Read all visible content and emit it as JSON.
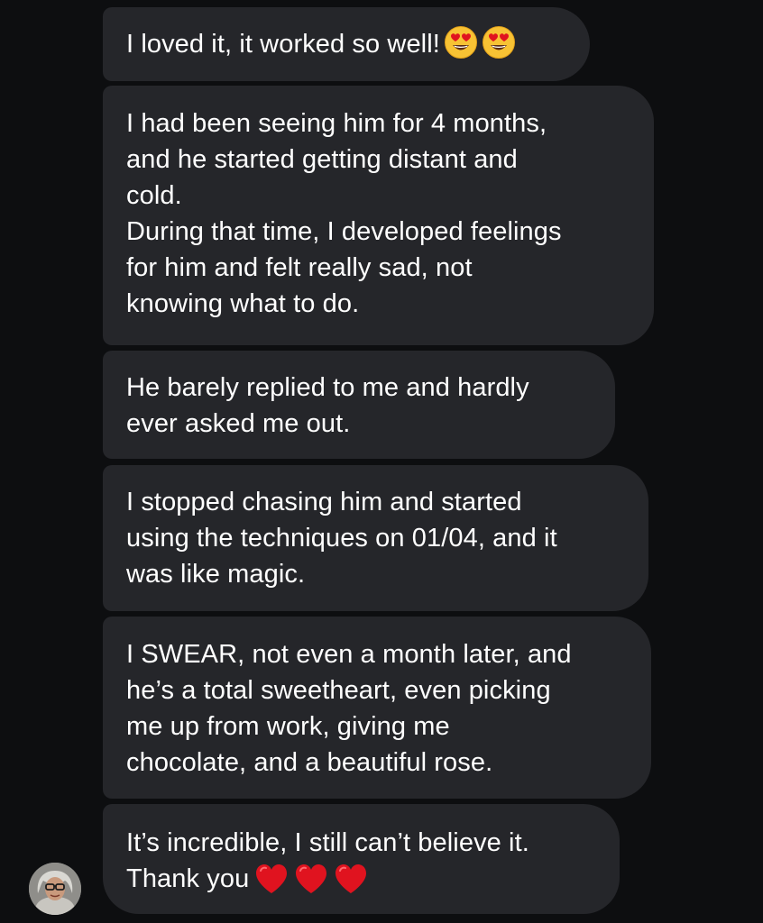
{
  "messages": [
    {
      "id": "msg1",
      "lines": "I loved it, it worked so well!",
      "trailing_emojis": [
        "smiling-face-with-heart-eyes",
        "smiling-face-with-heart-eyes"
      ]
    },
    {
      "id": "msg2",
      "lines": "I had been seeing him for 4 months,\nand he started getting distant and\ncold.\nDuring that time, I developed feelings\nfor him and felt really sad, not\nknowing what to do."
    },
    {
      "id": "msg3",
      "lines": "He barely replied to me and hardly\never asked me out."
    },
    {
      "id": "msg4",
      "lines": "I stopped chasing him and started\nusing the techniques on 01/04, and it\nwas like magic."
    },
    {
      "id": "msg5",
      "lines": "I SWEAR, not even a month later, and\nhe’s a total sweetheart, even picking\nme up from work, giving me\nchocolate, and a beautiful rose."
    },
    {
      "id": "msg6",
      "line1": "It’s incredible, I still can’t believe it.",
      "line2": "Thank you",
      "trailing_emojis": [
        "red-heart",
        "red-heart",
        "red-heart"
      ]
    }
  ],
  "colors": {
    "background": "#0d0e10",
    "bubble": "#25262a",
    "text": "#ffffff",
    "heart": "#e0131f",
    "emoji_face": "#f7c234"
  },
  "sender": {
    "avatar_icon": "user-avatar-photo"
  }
}
